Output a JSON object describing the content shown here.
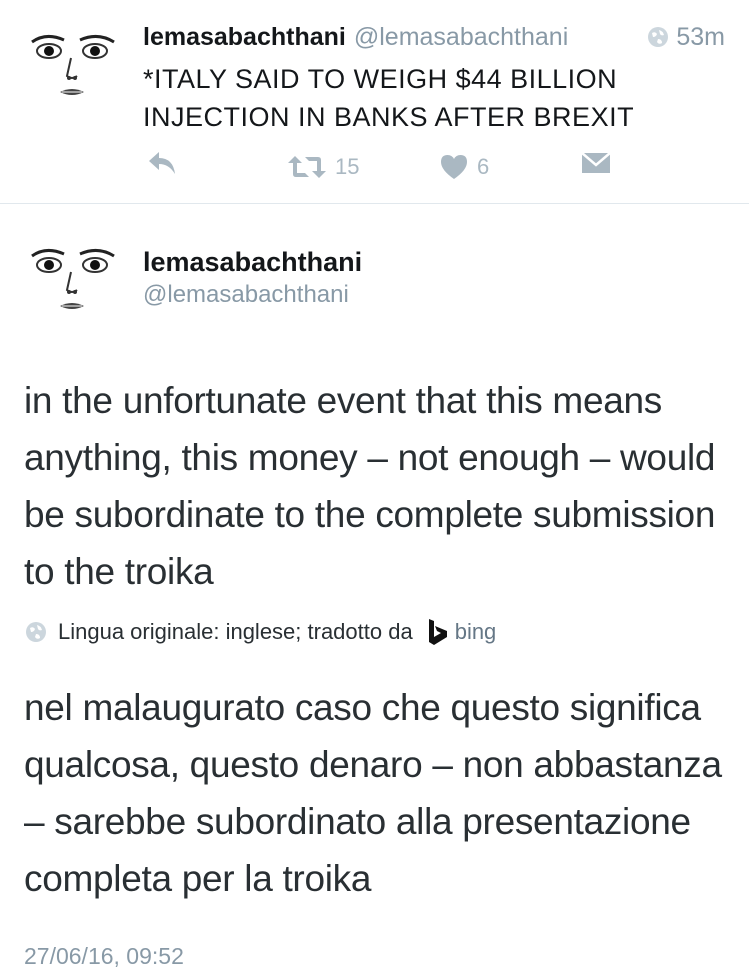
{
  "tweet1": {
    "display_name": "lemasabachthani",
    "handle": "@lemasabachthani",
    "time": "53m",
    "text": "*ITALY SAID TO WEIGH $44 BILLION INJECTION IN BANKS AFTER BREXIT",
    "retweet_count": "15",
    "like_count": "6",
    "icons": [
      "globe-icon",
      "reply-icon",
      "retweet-icon",
      "heart-icon",
      "direct-message-icon"
    ]
  },
  "tweet2": {
    "display_name": "lemasabachthani",
    "handle": "@lemasabachthani",
    "text": "in the unfortunate event that this means anything, this money – not enough – would be subordinate to the complete submission to the troika",
    "translation_note": "Lingua originale: inglese; tradotto da",
    "translator": "bing",
    "translated_text": "nel malaugurato caso che questo significa qualcosa, questo denaro – non abbastanza – sarebbe subordinato alla presentazione completa per la troika",
    "timestamp": "27/06/16, 09:52"
  },
  "colors": {
    "text": "#14171a",
    "muted": "#8899a6",
    "action_icons": "#aab8c2",
    "divider": "#e1e8ed"
  }
}
